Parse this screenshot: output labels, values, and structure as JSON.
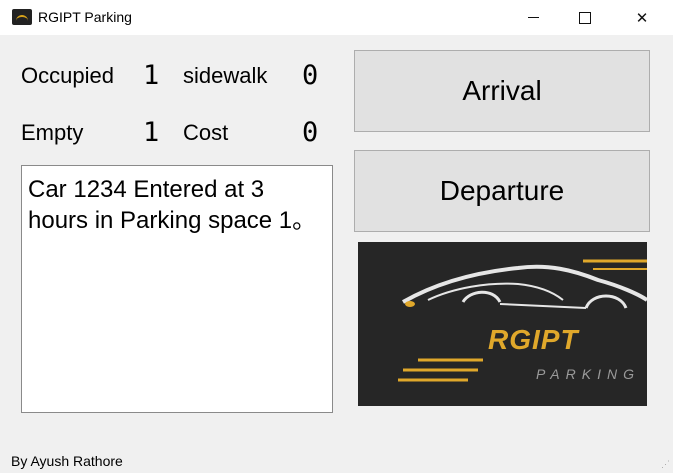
{
  "window": {
    "title": "RGIPT Parking",
    "icon": "car-logo-icon"
  },
  "stats": {
    "occupied_label": "Occupied",
    "occupied_value": "1",
    "sidewalk_label": "sidewalk",
    "sidewalk_value": "0",
    "empty_label": "Empty",
    "empty_value": "1",
    "cost_label": "Cost",
    "cost_value": "0"
  },
  "log": {
    "text": "Car 1234 Entered at 3 hours in Parking space 1。"
  },
  "buttons": {
    "arrival": "Arrival",
    "departure": "Departure"
  },
  "logo": {
    "title": "RGIPT",
    "subtitle": "PARKING"
  },
  "footer": {
    "credit": "By Ayush Rathore"
  },
  "colors": {
    "logo_bg": "#262626",
    "logo_accent": "#e0a82b"
  }
}
